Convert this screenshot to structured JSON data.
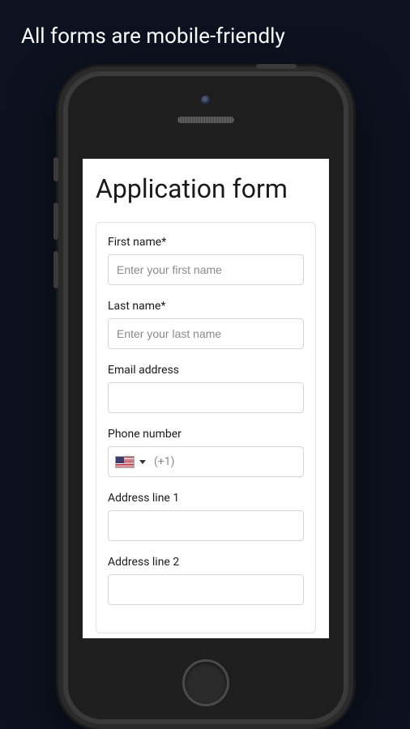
{
  "tagline": "All forms are mobile-friendly",
  "form": {
    "title": "Application form",
    "fields": {
      "first_name": {
        "label": "First name*",
        "placeholder": "Enter your first name",
        "value": ""
      },
      "last_name": {
        "label": "Last name*",
        "placeholder": "Enter your last name",
        "value": ""
      },
      "email": {
        "label": "Email address",
        "placeholder": "",
        "value": ""
      },
      "phone": {
        "label": "Phone number",
        "dial_code": "(+1)",
        "country": "US",
        "value": ""
      },
      "address1": {
        "label": "Address line 1",
        "placeholder": "",
        "value": ""
      },
      "address2": {
        "label": "Address line 2",
        "placeholder": "",
        "value": ""
      }
    }
  }
}
